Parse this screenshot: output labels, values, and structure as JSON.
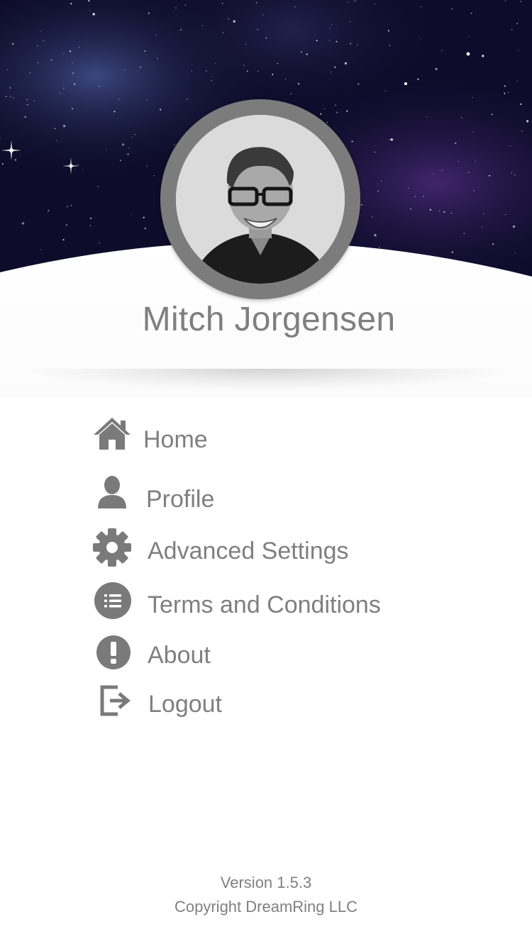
{
  "profile": {
    "name": "Mitch Jorgensen",
    "avatar_icon": "profile-photo"
  },
  "menu": [
    {
      "key": "home",
      "label": "Home",
      "icon": "home-icon"
    },
    {
      "key": "profile",
      "label": "Profile",
      "icon": "person-icon"
    },
    {
      "key": "advanced-settings",
      "label": "Advanced Settings",
      "icon": "gear-icon"
    },
    {
      "key": "terms",
      "label": "Terms and Conditions",
      "icon": "list-icon"
    },
    {
      "key": "about",
      "label": "About",
      "icon": "exclamation-icon"
    },
    {
      "key": "logout",
      "label": "Logout",
      "icon": "logout-icon"
    }
  ],
  "footer": {
    "version": "Version 1.5.3",
    "copyright": "Copyright DreamRing LLC"
  },
  "colors": {
    "text_gray": "#7f7f7f",
    "icon_gray": "#7a7a7a",
    "space_dark": "#0d0c2a",
    "space_purple": "#3a2a66"
  }
}
